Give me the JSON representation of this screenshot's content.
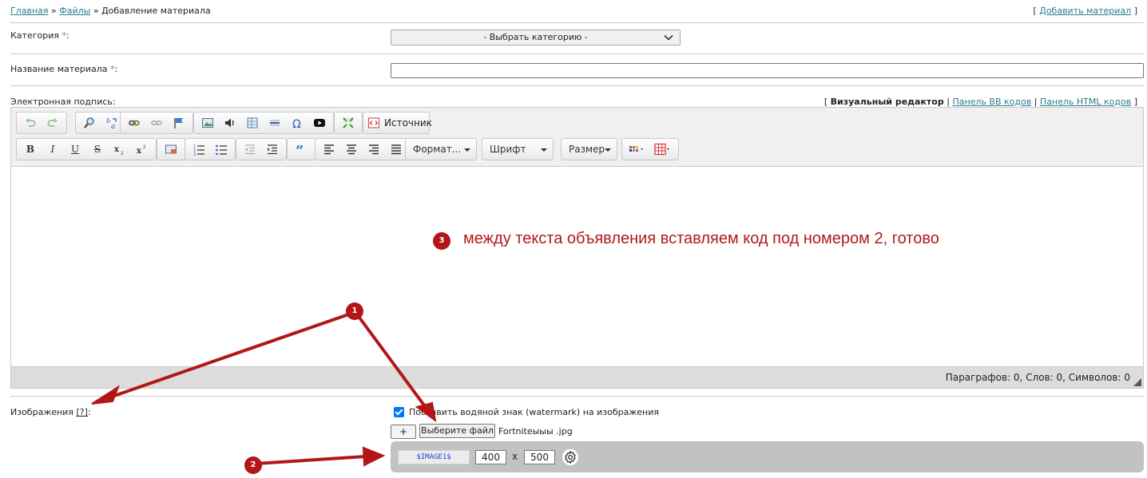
{
  "breadcrumb": {
    "home": "Главная",
    "sep1": " » ",
    "files": "Файлы",
    "sep2": " » ",
    "current": "Добавление материала"
  },
  "top_action": {
    "open": "[ ",
    "label": "Добавить материал",
    "close": " ]"
  },
  "category": {
    "label": "Категория ",
    "required": "*",
    "suffix": ":",
    "select_value": "- Выбрать категорию -"
  },
  "title_field": {
    "label": "Название материала ",
    "required": "*",
    "suffix": ":",
    "value": ""
  },
  "signature": {
    "label": "Электронная подпись:"
  },
  "editor_modes": {
    "open": "[ ",
    "visual": "Визуальный редактор",
    "sep": " | ",
    "bb": "Панель BB кодов",
    "html": "Панель HTML кодов",
    "close": " ]"
  },
  "toolbar": {
    "source": "Источник",
    "bold": "B",
    "italic": "I",
    "underline": "U",
    "strike": "S",
    "format": "Формат...",
    "font": "Шрифт",
    "size": "Размер"
  },
  "statusbar": {
    "stats": "Параграфов: 0, Слов: 0, Символов: 0"
  },
  "annotations": {
    "note3": "между текста объявления вставляем код под номером 2, готово",
    "m1": "1",
    "m2": "2",
    "m3": "3"
  },
  "images": {
    "label": "Изображения ",
    "help": "[?]",
    "suffix": ":",
    "watermark_label": "Поставить водяной знак (watermark) на изображения",
    "watermark_checked": true,
    "plus_label": "+",
    "choose_file": "Выберите файл",
    "file_name": "Fortniteыыы .jpg",
    "image_code": "$IMAGE1$",
    "width": "400",
    "times": "x",
    "height": "500"
  },
  "colors": {
    "link": "#2a7b8f",
    "annotation": "#b21616",
    "checkbox": "#0075ff"
  }
}
